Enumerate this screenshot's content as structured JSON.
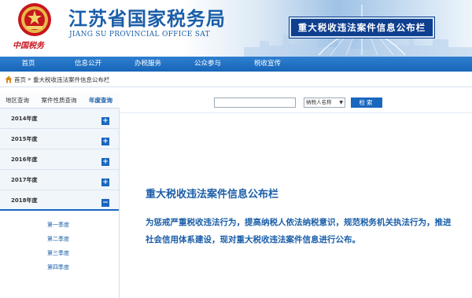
{
  "header": {
    "title": "江苏省国家税务局",
    "subtitle": "JIANG SU PROVINCIAL OFFICE SAT",
    "logo_text": "中国税务",
    "banner": "重大税收违法案件信息公布栏"
  },
  "nav": {
    "items": [
      {
        "label": "首页"
      },
      {
        "label": "信息公开"
      },
      {
        "label": "办税服务"
      },
      {
        "label": "公众参与"
      },
      {
        "label": "税收宣传"
      }
    ]
  },
  "breadcrumb": {
    "home": "首页",
    "separator": "»",
    "current": "重大税收违法案件信息公布栏"
  },
  "sidebar": {
    "tabs": [
      {
        "label": "地区查询"
      },
      {
        "label": "案件性质查询"
      },
      {
        "label": "年度查询"
      }
    ],
    "years": [
      {
        "label": "2014年度",
        "toggle": "+"
      },
      {
        "label": "2015年度",
        "toggle": "+"
      },
      {
        "label": "2016年度",
        "toggle": "+"
      },
      {
        "label": "2017年度",
        "toggle": "+"
      },
      {
        "label": "2018年度",
        "toggle": "−"
      }
    ],
    "quarters": [
      {
        "label": "第一季度"
      },
      {
        "label": "第二季度"
      },
      {
        "label": "第三季度"
      },
      {
        "label": "第四季度"
      }
    ]
  },
  "search": {
    "input_value": "",
    "select_value": "纳税人名称",
    "button_label": "检索"
  },
  "main": {
    "title": "重大税收违法案件信息公布栏",
    "description": "为惩戒严重税收违法行为，提高纳税人依法纳税意识，规范税务机关执法行为，推进社会信用体系建设，现对重大税收违法案件信息进行公布。"
  },
  "colors": {
    "brand_blue": "#1a5ea8",
    "nav_blue": "#1766b9",
    "banner_blue": "#0f3f8f",
    "logo_red": "#c8161d"
  }
}
